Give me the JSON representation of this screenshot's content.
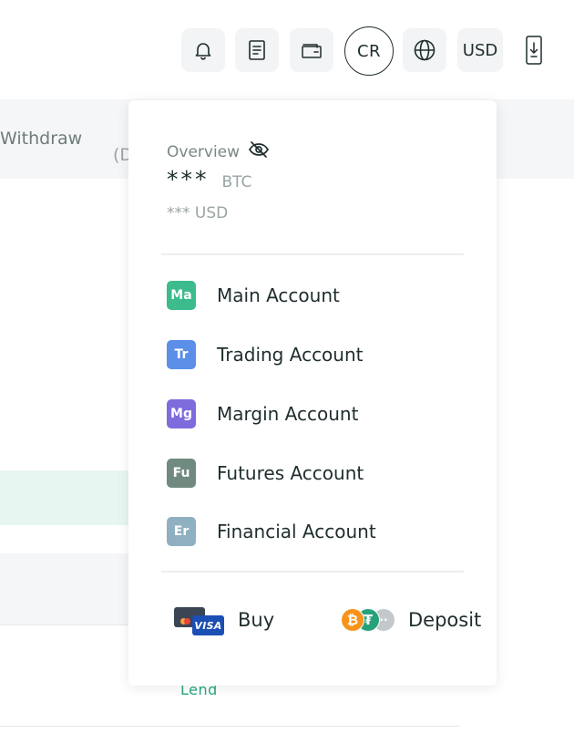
{
  "toolbar": {
    "bell_icon": "bell-icon",
    "orders_icon": "document-icon",
    "wallet_icon": "wallet-icon",
    "avatar_initials": "CR",
    "language_icon": "globe-icon",
    "currency": "USD",
    "download_icon": "phone-download-icon"
  },
  "background": {
    "withdraw_label": "Withdraw",
    "partial_label": "(D",
    "lend_label": "Lend"
  },
  "overview": {
    "label": "Overview",
    "hide_icon": "eye-off-icon",
    "btc_value": "***",
    "btc_unit": "BTC",
    "usd_value": "*** USD"
  },
  "accounts": [
    {
      "abbr": "Ma",
      "label": "Main Account",
      "color": "#3dbb8d"
    },
    {
      "abbr": "Tr",
      "label": "Trading Account",
      "color": "#5b8fe8"
    },
    {
      "abbr": "Mg",
      "label": "Margin Account",
      "color": "#7e6cdc"
    },
    {
      "abbr": "Fu",
      "label": "Futures Account",
      "color": "#708a80"
    },
    {
      "abbr": "Er",
      "label": "Financial Account",
      "color": "#8fb0c0"
    }
  ],
  "actions": {
    "buy_label": "Buy",
    "card_brand": "VISA",
    "deposit_label": "Deposit",
    "coin_btc_symbol": "₿",
    "coin_usdt_symbol": "₮",
    "coin_more_symbol": "··"
  },
  "colors": {
    "accent_green": "#23a981",
    "text_dark": "#1f2d2e",
    "text_muted": "#9aa3a4"
  }
}
